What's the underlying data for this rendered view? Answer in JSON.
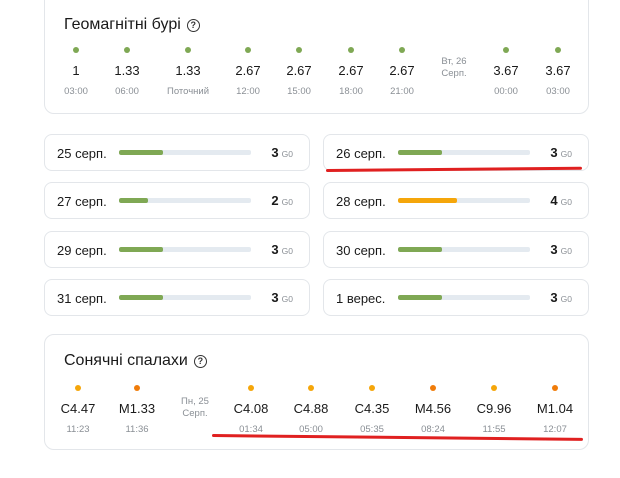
{
  "colors": {
    "green": "#7fa854",
    "orange": "#f5a60a",
    "darkorange": "#f07c0a",
    "red": "#e02020"
  },
  "storms": {
    "title": "Геомагнітні бурі",
    "help_icon": "question-circle-icon",
    "day_marker": {
      "line1": "Вт, 26",
      "line2": "Серп."
    },
    "items": [
      {
        "value": "1",
        "time": "03:00"
      },
      {
        "value": "1.33",
        "time": "06:00"
      },
      {
        "value": "1.33",
        "time": "Поточний"
      },
      {
        "value": "2.67",
        "time": "12:00"
      },
      {
        "value": "2.67",
        "time": "15:00"
      },
      {
        "value": "2.67",
        "time": "18:00"
      },
      {
        "value": "2.67",
        "time": "21:00"
      },
      {
        "value": "3.67",
        "time": "00:00"
      },
      {
        "value": "3.67",
        "time": "03:00"
      }
    ]
  },
  "forecast": [
    {
      "date": "25 серп.",
      "kp": "3",
      "unit": "G0",
      "level": 3,
      "color": "green"
    },
    {
      "date": "26 серп.",
      "kp": "3",
      "unit": "G0",
      "level": 3,
      "color": "green"
    },
    {
      "date": "27 серп.",
      "kp": "2",
      "unit": "G0",
      "level": 2,
      "color": "green"
    },
    {
      "date": "28 серп.",
      "kp": "4",
      "unit": "G0",
      "level": 4,
      "color": "orange"
    },
    {
      "date": "29 серп.",
      "kp": "3",
      "unit": "G0",
      "level": 3,
      "color": "green"
    },
    {
      "date": "30 серп.",
      "kp": "3",
      "unit": "G0",
      "level": 3,
      "color": "green"
    },
    {
      "date": "31 серп.",
      "kp": "3",
      "unit": "G0",
      "level": 3,
      "color": "green"
    },
    {
      "date": "1 верес.",
      "kp": "3",
      "unit": "G0",
      "level": 3,
      "color": "green"
    }
  ],
  "flares": {
    "title": "Сонячні спалахи",
    "help_icon": "question-circle-icon",
    "day_marker": {
      "line1": "Пн, 25",
      "line2": "Серп."
    },
    "items": [
      {
        "value": "C4.47",
        "time": "11:23",
        "color": "orange"
      },
      {
        "value": "M1.33",
        "time": "11:36",
        "color": "darkorange"
      },
      {
        "value": "C4.08",
        "time": "01:34",
        "color": "orange"
      },
      {
        "value": "C4.88",
        "time": "05:00",
        "color": "orange"
      },
      {
        "value": "C4.35",
        "time": "05:35",
        "color": "orange"
      },
      {
        "value": "M4.56",
        "time": "08:24",
        "color": "darkorange"
      },
      {
        "value": "C9.96",
        "time": "11:55",
        "color": "orange"
      },
      {
        "value": "M1.04",
        "time": "12:07",
        "color": "darkorange"
      }
    ]
  }
}
